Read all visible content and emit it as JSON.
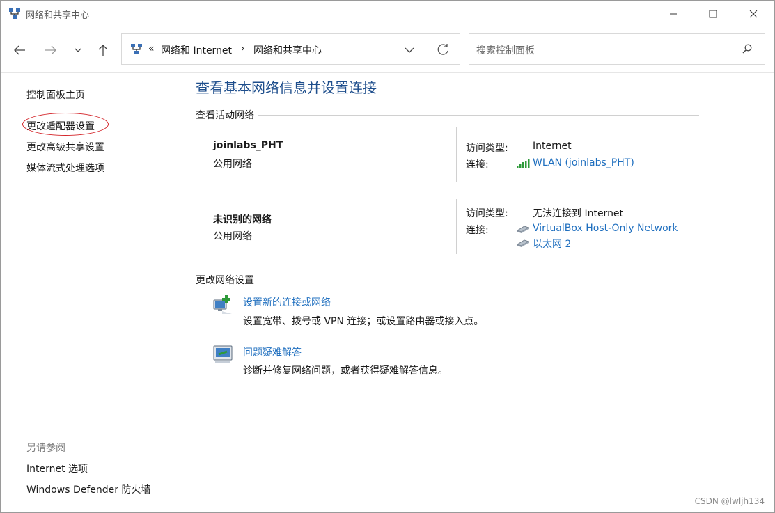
{
  "window": {
    "title": "网络和共享中心",
    "controls": {
      "minimize": "minimize",
      "maximize": "maximize",
      "close": "close"
    }
  },
  "nav": {
    "breadcrumb_prefix": "«",
    "breadcrumb": [
      "网络和 Internet",
      "网络和共享中心"
    ],
    "separator": "›",
    "search_placeholder": "搜索控制面板"
  },
  "sidebar": {
    "items": [
      {
        "label": "控制面板主页"
      },
      {
        "label": "更改适配器设置"
      },
      {
        "label": "更改高级共享设置"
      },
      {
        "label": "媒体流式处理选项"
      }
    ],
    "see_also_title": "另请参阅",
    "see_also": [
      {
        "label": "Internet 选项"
      },
      {
        "label": "Windows Defender 防火墙"
      }
    ]
  },
  "main": {
    "title": "查看基本网络信息并设置连接",
    "active_section": "查看活动网络",
    "networks": [
      {
        "name": "joinlabs_PHT",
        "type": "公用网络",
        "access_label": "访问类型:",
        "access_value": "Internet",
        "conn_label": "连接:",
        "connections": [
          "WLAN (joinlabs_PHT)"
        ]
      },
      {
        "name": "未识别的网络",
        "type": "公用网络",
        "access_label": "访问类型:",
        "access_value": "无法连接到 Internet",
        "conn_label": "连接:",
        "connections": [
          "VirtualBox Host-Only Network",
          "以太网 2"
        ]
      }
    ],
    "change_section": "更改网络设置",
    "tasks": [
      {
        "label": "设置新的连接或网络",
        "desc": "设置宽带、拨号或 VPN 连接；或设置路由器或接入点。"
      },
      {
        "label": "问题疑难解答",
        "desc": "诊断并修复网络问题，或者获得疑难解答信息。"
      }
    ]
  },
  "watermark": "CSDN @lwljh134",
  "colors": {
    "link": "#1f6fbf",
    "title": "#1e4e8c",
    "highlight": "#d4262b"
  }
}
